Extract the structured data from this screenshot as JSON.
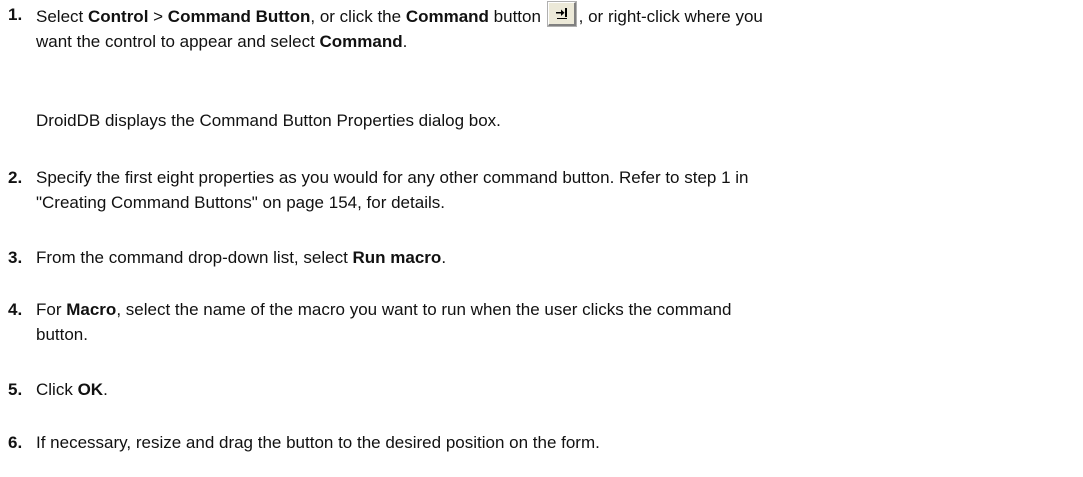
{
  "steps": [
    {
      "number": "1.",
      "line1_a": "Select ",
      "b1": "Control",
      "line1_b": " > ",
      "b2": "Command Button",
      "line1_c": ", or click the ",
      "b3": "Command",
      "line1_d": " button ",
      "line1_e": ", or right-click where you",
      "line2_a": "want the control to appear and select ",
      "b4": "Command",
      "line2_b": ".",
      "icon": "command-button-icon"
    },
    {
      "number": "2.",
      "line1": "Specify the first eight properties as you would for any other command button. Refer to step 1 in",
      "line2": "\"Creating Command Buttons\" on page 154, for details."
    },
    {
      "number": "3.",
      "text_a": "From the command drop-down list, select ",
      "bold": "Run macro",
      "text_b": "."
    },
    {
      "number": "4.",
      "text_a": "For ",
      "bold": "Macro",
      "line1_b": ", select the name of the macro you want to run when the user clicks the command",
      "line2": "button."
    },
    {
      "number": "5.",
      "text_a": "Click ",
      "bold": "OK",
      "text_b": "."
    },
    {
      "number": "6.",
      "text": "If necessary, resize and drag the button to the desired position on the form."
    }
  ],
  "note": "DroidDB displays the Command Button Properties dialog box."
}
